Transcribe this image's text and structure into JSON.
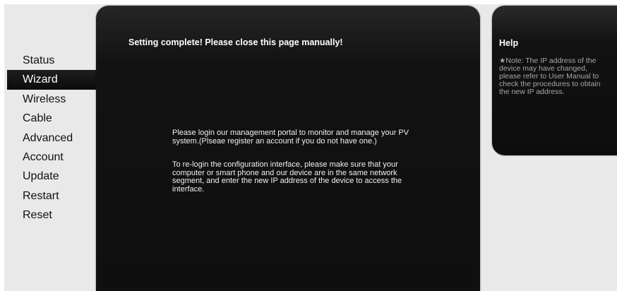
{
  "sidebar": {
    "items": [
      {
        "label": "Status",
        "active": false
      },
      {
        "label": "Wizard",
        "active": true
      },
      {
        "label": "Wireless",
        "active": false
      },
      {
        "label": "Cable",
        "active": false
      },
      {
        "label": "Advanced",
        "active": false
      },
      {
        "label": "Account",
        "active": false
      },
      {
        "label": "Update",
        "active": false
      },
      {
        "label": "Restart",
        "active": false
      },
      {
        "label": "Reset",
        "active": false
      }
    ]
  },
  "main": {
    "title": "Setting complete! Please close this page manually!",
    "message_portal": "Please login our management portal to monitor and manage your PV system.(Plseae register an account if you do not have one.)",
    "message_relogin": "To re-login the configuration interface, please make sure that your computer or smart phone and our device are in the same network segment, and enter the new IP address of the device to access the interface."
  },
  "help": {
    "title": "Help",
    "text": "★Note: The IP address of the device may have changed, please refer to User Manual to check the procedures to obtain the new IP address."
  }
}
